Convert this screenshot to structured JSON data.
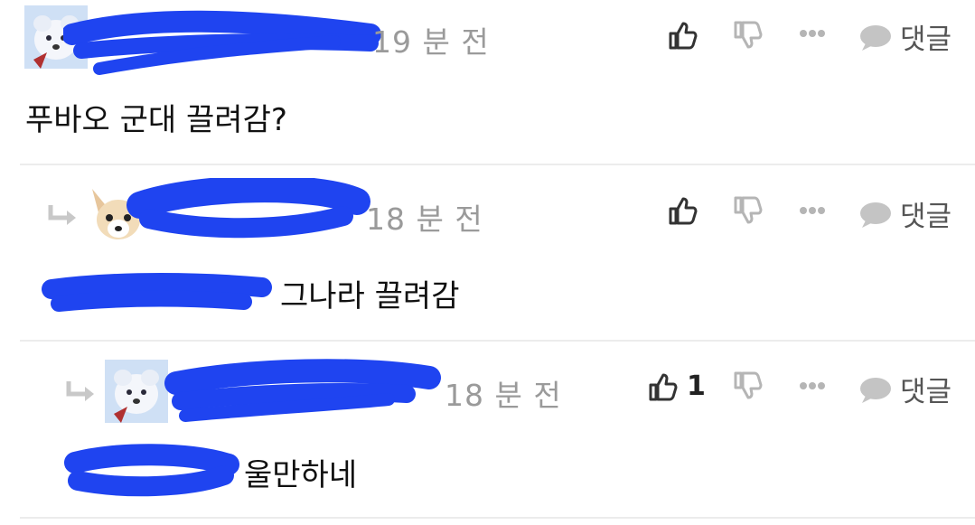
{
  "comments": [
    {
      "time": "19 분 전",
      "text": "푸바오 군대 끌려감?",
      "likes": "",
      "reply_label": "댓글",
      "is_reply": false
    },
    {
      "time": "18 분 전",
      "text": "그나라 끌려감",
      "likes": "",
      "reply_label": "댓글",
      "is_reply": true
    },
    {
      "time": "18 분 전",
      "text": "울만하네",
      "likes": "1",
      "reply_label": "댓글",
      "is_reply": true
    }
  ],
  "icons": {
    "like": "thumbs-up-icon",
    "dislike": "thumbs-down-icon",
    "more": "more-dots-icon",
    "reply": "speech-bubble-icon",
    "reply_arrow": "reply-arrow-icon"
  },
  "colors": {
    "redaction": "#1f44f0",
    "muted": "#9a9a9a",
    "icon": "#333333",
    "icon_light": "#b5b5b5"
  }
}
